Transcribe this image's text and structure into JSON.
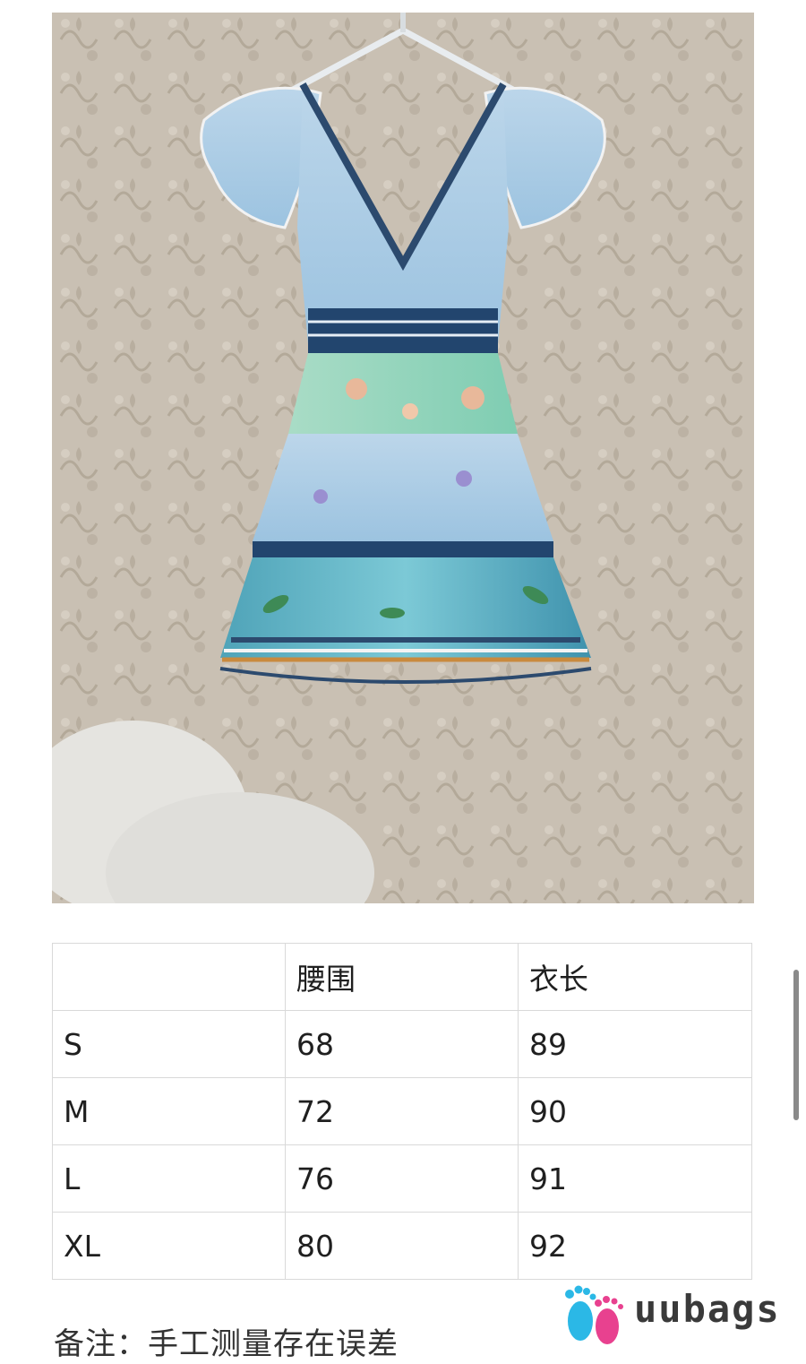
{
  "product_photo": {
    "alt": "floral tiered ruffle dress on hanger"
  },
  "size_table": {
    "header": [
      "",
      "腰围",
      "衣长"
    ],
    "rows": [
      [
        "S",
        "68",
        "89"
      ],
      [
        "M",
        "72",
        "90"
      ],
      [
        "L",
        "76",
        "91"
      ],
      [
        "XL",
        "80",
        "92"
      ]
    ]
  },
  "note": "备注：手工测量存在误差",
  "watermark": {
    "text": "uubags",
    "icon": "footprints-icon"
  },
  "colors": {
    "table_border": "#d9d9d9",
    "watermark_pink": "#e8418f",
    "watermark_cyan": "#2bb8e6"
  }
}
